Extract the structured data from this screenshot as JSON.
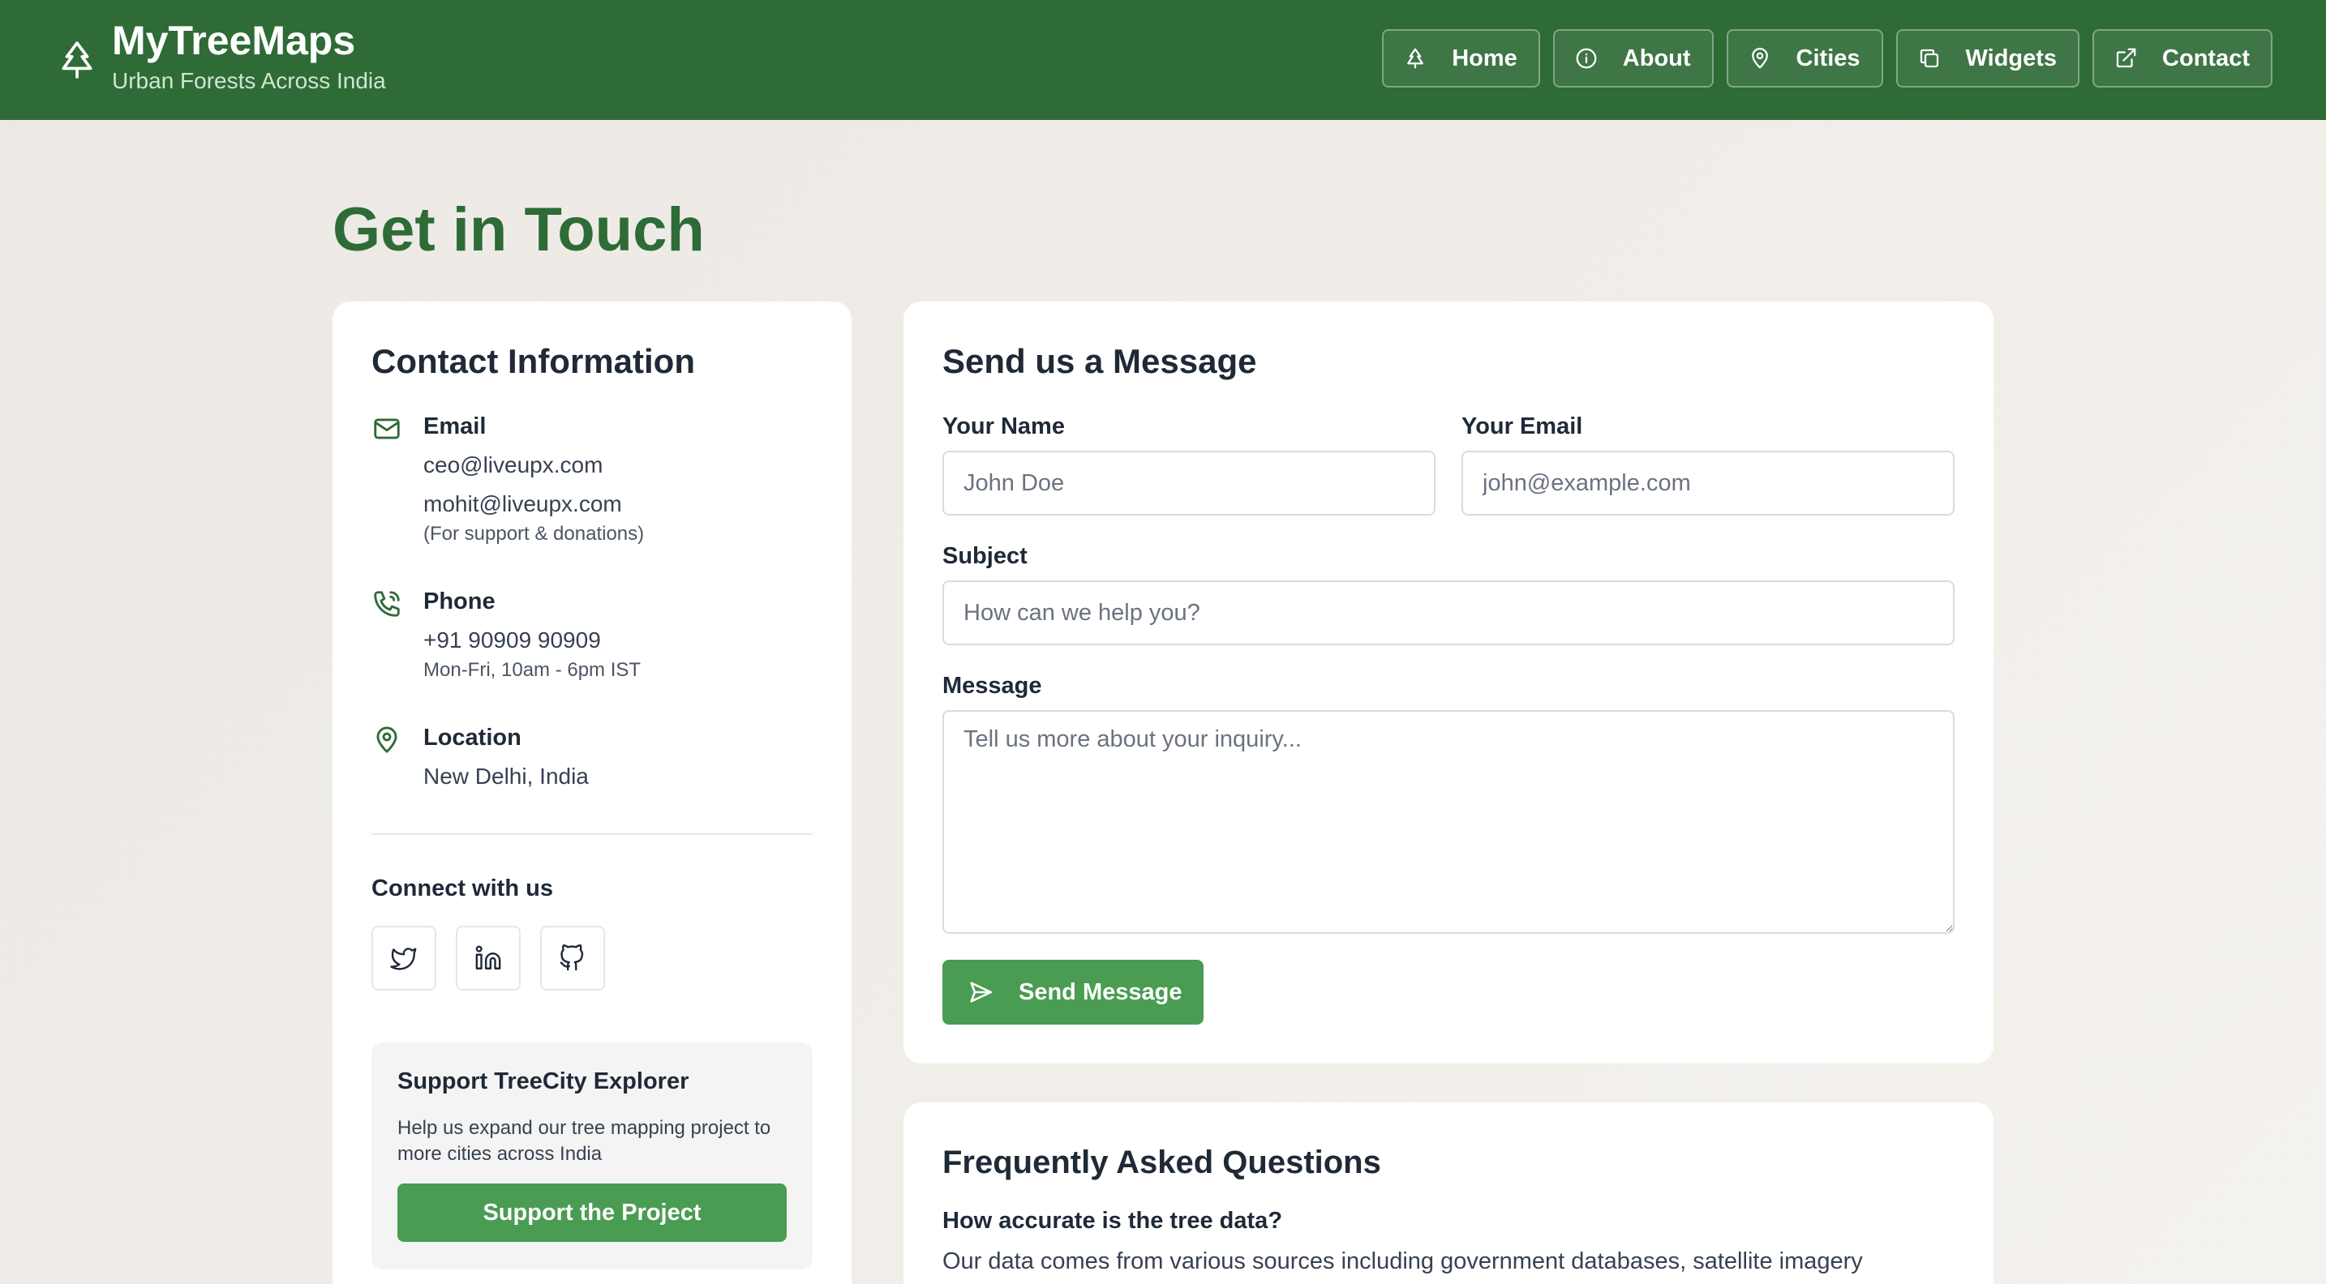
{
  "header": {
    "title": "MyTreeMaps",
    "subtitle": "Urban Forests Across India",
    "nav": [
      {
        "label": "Home",
        "icon": "tree-icon"
      },
      {
        "label": "About",
        "icon": "info-icon"
      },
      {
        "label": "Cities",
        "icon": "map-pin-icon"
      },
      {
        "label": "Widgets",
        "icon": "copy-icon"
      },
      {
        "label": "Contact",
        "icon": "external-link-icon"
      }
    ]
  },
  "page": {
    "title": "Get in Touch"
  },
  "contact": {
    "heading": "Contact Information",
    "email": {
      "label": "Email",
      "primary": "ceo@liveupx.com",
      "secondary": "mohit@liveupx.com",
      "note": "(For support & donations)"
    },
    "phone": {
      "label": "Phone",
      "value": "+91 90909 90909",
      "hours": "Mon-Fri, 10am - 6pm IST"
    },
    "location": {
      "label": "Location",
      "value": "New Delhi, India"
    },
    "connect_label": "Connect with us",
    "social": [
      "twitter-icon",
      "linkedin-icon",
      "github-icon"
    ],
    "support": {
      "title": "Support TreeCity Explorer",
      "text": "Help us expand our tree mapping project to more cities across India",
      "button": "Support the Project"
    }
  },
  "form": {
    "heading": "Send us a Message",
    "name_label": "Your Name",
    "name_placeholder": "John Doe",
    "email_label": "Your Email",
    "email_placeholder": "john@example.com",
    "subject_label": "Subject",
    "subject_placeholder": "How can we help you?",
    "message_label": "Message",
    "message_placeholder": "Tell us more about your inquiry...",
    "submit": "Send Message"
  },
  "faq": {
    "heading": "Frequently Asked Questions",
    "items": [
      {
        "question": "How accurate is the tree data?",
        "answer": "Our data comes from various sources including government databases, satellite imagery"
      }
    ]
  },
  "colors": {
    "header_bg": "#2e6b37",
    "accent": "#4a9c52",
    "title_green": "#2e6b37"
  }
}
